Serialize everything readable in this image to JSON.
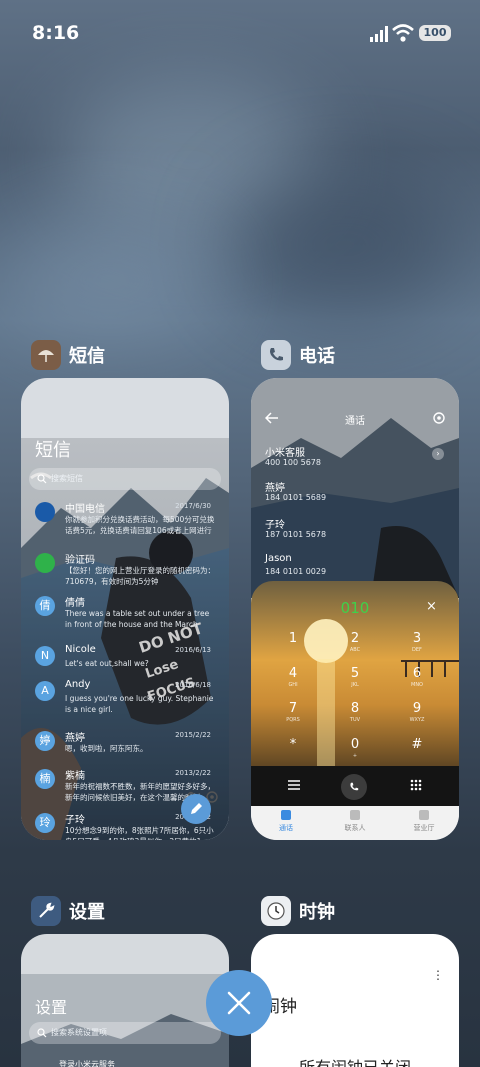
{
  "status": {
    "time": "8:16",
    "battery": "100"
  },
  "apps": {
    "messages": {
      "name": "短信",
      "title": "短信",
      "search_placeholder": "搜索短信",
      "threads": [
        {
          "name": "中国电信",
          "date": "2017/6/30",
          "preview": "你就参加积分兑换话费活动，每500分可兑换话费5元，兑换话费请回复106或者上网进行话费...",
          "avatar": "",
          "color": "#1a5aa8"
        },
        {
          "name": "验证码",
          "date": "",
          "preview": "【您好！您的网上营业厅登录的随机密码为：710679，有效时间为5分钟",
          "avatar": "",
          "color": "#2fb24a"
        },
        {
          "name": "倩倩",
          "date": "",
          "preview": "There was a table set out under a tree in front of the house and the March Hare and...",
          "avatar": "倩",
          "color": "#5aa3e0"
        },
        {
          "name": "Nicole",
          "date": "2016/6/13",
          "preview": "Let's eat out,shall we?",
          "avatar": "N",
          "color": "#5aa3e0"
        },
        {
          "name": "Andy",
          "date": "2016/6/18",
          "preview": "I guess you're one lucky guy. Stephanie is a nice girl.",
          "avatar": "A",
          "color": "#5aa3e0"
        },
        {
          "name": "燕婷",
          "date": "2015/2/22",
          "preview": "嗯，收到啦，阿东阿东。",
          "avatar": "婷",
          "color": "#5aa3e0"
        },
        {
          "name": "紫楠",
          "date": "2013/2/22",
          "preview": "新年的祝福数不胜数，新年的愿望好多好多，新年的问候依旧美好，在这个温馨的时刻...",
          "avatar": "楠",
          "color": "#5aa3e0"
        },
        {
          "name": "子玲",
          "date": "2013/2/22",
          "preview": "10分想念9到的你，8张照片7所居你，6只小鸟5只可爱，4朵玫瑰3最似你，2只黄的1只...",
          "avatar": "玲",
          "color": "#5aa3e0"
        }
      ]
    },
    "phone": {
      "name": "电话",
      "title": "通话",
      "contacts": [
        {
          "name": "小米客服",
          "number": "400 100 5678"
        },
        {
          "name": "燕婷",
          "number": "184 0101 5689"
        },
        {
          "name": "子玲",
          "number": "187 0101 5678"
        },
        {
          "name": "Jason",
          "number": "184 0101 0029"
        }
      ],
      "dial_input": "010",
      "keys": [
        {
          "d": "1",
          "s": ""
        },
        {
          "d": "2",
          "s": "ABC"
        },
        {
          "d": "3",
          "s": "DEF"
        },
        {
          "d": "4",
          "s": "GHI"
        },
        {
          "d": "5",
          "s": "JKL"
        },
        {
          "d": "6",
          "s": "MNO"
        },
        {
          "d": "7",
          "s": "PQRS"
        },
        {
          "d": "8",
          "s": "TUV"
        },
        {
          "d": "9",
          "s": "WXYZ"
        },
        {
          "d": "*",
          "s": ""
        },
        {
          "d": "0",
          "s": "+"
        },
        {
          "d": "#",
          "s": ""
        }
      ],
      "tabs": [
        "通话",
        "联系人",
        "营业厅"
      ]
    },
    "settings": {
      "name": "设置",
      "title": "设置",
      "search_placeholder": "搜索系统设置项",
      "first_item": "登录小米云服务"
    },
    "clock": {
      "name": "时钟",
      "title": "闹钟",
      "empty_text": "所有闹钟已关闭"
    }
  },
  "colors": {
    "accent": "#5b9bd8",
    "dial_green": "#3fd14a"
  }
}
